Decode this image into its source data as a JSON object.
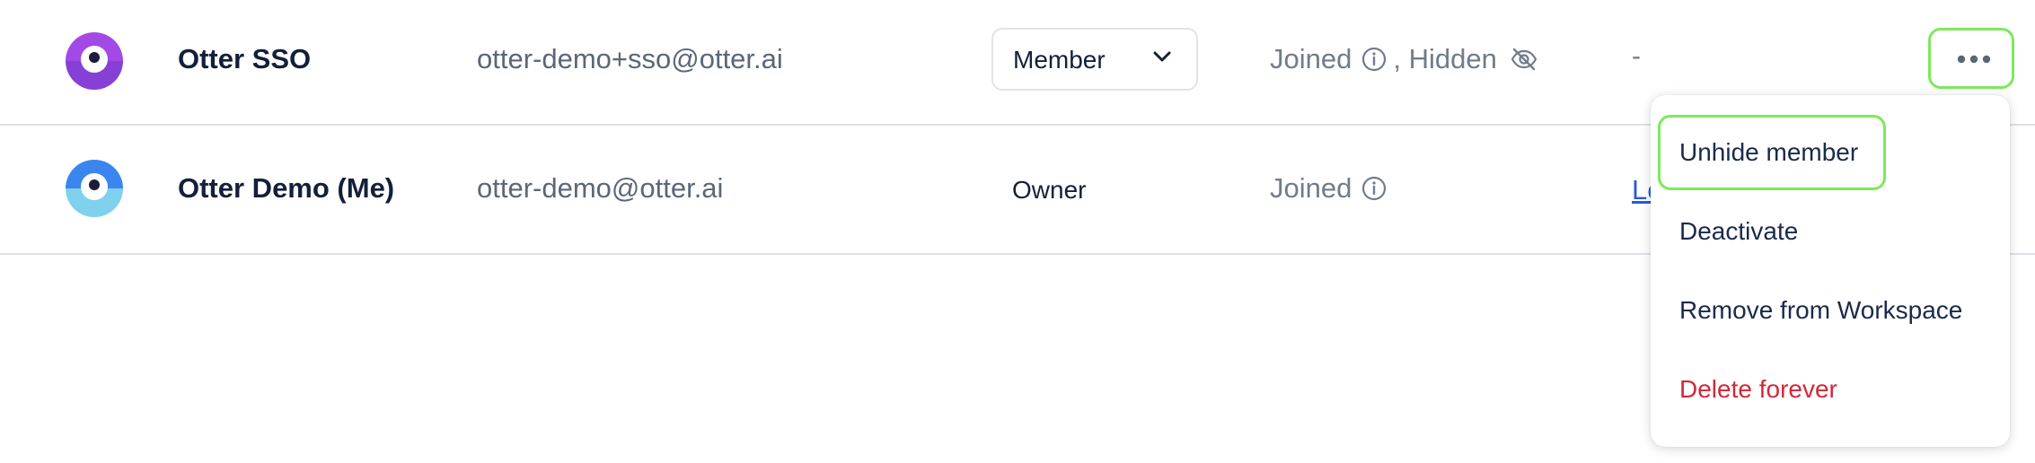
{
  "members": [
    {
      "name": "Otter SSO",
      "email": "otter-demo+sso@otter.ai",
      "role": "Member",
      "status_joined": "Joined",
      "status_extra": ", Hidden",
      "extra": "-",
      "avatar_color": "#9b3fe0",
      "avatar_icon": "otter-avatar-icon"
    },
    {
      "name": "Otter Demo (Me)",
      "email": "otter-demo@otter.ai",
      "role": "Owner",
      "status_joined": "Joined",
      "extra_link": "Le",
      "avatar_color": "#3b8bf0",
      "avatar_icon": "otter-avatar-icon"
    }
  ],
  "actions_menu": {
    "items": [
      {
        "label": "Unhide member"
      },
      {
        "label": "Deactivate"
      },
      {
        "label": "Remove from Workspace"
      },
      {
        "label": "Delete forever",
        "style": "danger"
      }
    ]
  },
  "colors": {
    "highlight": "#7ee85c",
    "danger": "#d2283a",
    "link": "#2a5bd7"
  }
}
